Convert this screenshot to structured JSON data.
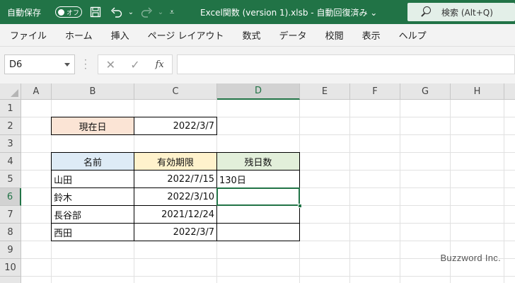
{
  "titlebar": {
    "autosave_label": "自動保存",
    "autosave_state": "オフ",
    "document_title": "Excel関数 (version 1).xlsb  -  自動回復済み  ⌄",
    "search_placeholder": "検索 (Alt+Q)",
    "accent_color": "#217346",
    "icons": [
      "save-icon",
      "undo-icon",
      "redo-icon",
      "customize-qat-icon"
    ]
  },
  "menu": {
    "items": [
      "ファイル",
      "ホーム",
      "挿入",
      "ページ レイアウト",
      "数式",
      "データ",
      "校閲",
      "表示",
      "ヘルプ"
    ]
  },
  "formula_bar": {
    "name_box": "D6",
    "formula": "",
    "fx_label": "fx"
  },
  "grid": {
    "columns": [
      "A",
      "B",
      "C",
      "D",
      "E",
      "F",
      "G",
      "H"
    ],
    "selected_column": "D",
    "rows": [
      "1",
      "2",
      "3",
      "4",
      "5",
      "6",
      "7",
      "8",
      "9",
      "10"
    ],
    "selected_row": "6",
    "active_cell": "D6"
  },
  "sheet": {
    "current_date_label": "現在日",
    "current_date_value": "2022/3/7",
    "table": {
      "headers": [
        "名前",
        "有効期限",
        "残日数"
      ],
      "rows": [
        {
          "name": "山田",
          "expiry": "2022/7/15",
          "remaining": "130日"
        },
        {
          "name": "鈴木",
          "expiry": "2022/3/10",
          "remaining": ""
        },
        {
          "name": "長谷部",
          "expiry": "2021/12/24",
          "remaining": ""
        },
        {
          "name": "西田",
          "expiry": "2022/3/7",
          "remaining": ""
        }
      ]
    }
  },
  "watermark": "Buzzword Inc."
}
